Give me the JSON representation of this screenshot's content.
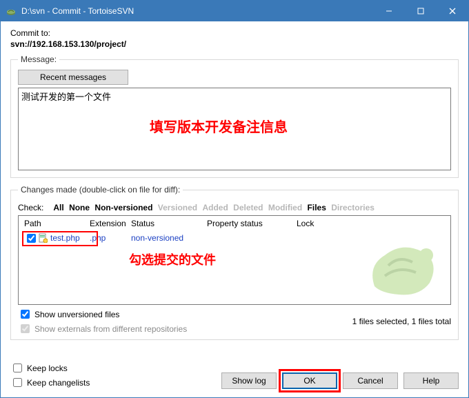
{
  "window": {
    "title": "D:\\svn - Commit - TortoiseSVN"
  },
  "commitTo": {
    "label": "Commit to:",
    "url": "svn://192.168.153.130/project/"
  },
  "messageSection": {
    "legend": "Message:",
    "recentButton": "Recent messages",
    "messageText": "测试开发的第一个文件",
    "annotation": "填写版本开发备注信息"
  },
  "changesSection": {
    "legend": "Changes made (double-click on file for diff):",
    "checkLabel": "Check:",
    "filters": {
      "all": "All",
      "none": "None",
      "nonversioned": "Non-versioned",
      "versioned": "Versioned",
      "added": "Added",
      "deleted": "Deleted",
      "modified": "Modified",
      "files": "Files",
      "directories": "Directories"
    },
    "columns": {
      "path": "Path",
      "extension": "Extension",
      "status": "Status",
      "propertyStatus": "Property status",
      "lock": "Lock"
    },
    "rows": [
      {
        "checked": true,
        "name": "test.php",
        "ext": ".php",
        "status": "non-versioned",
        "prop": "",
        "lock": ""
      }
    ],
    "annotation": "勾选提交的文件",
    "showUnversioned": "Show unversioned files",
    "showExternals": "Show externals from different repositories",
    "statusRight": "1 files selected, 1 files total"
  },
  "footer": {
    "keepLocks": "Keep locks",
    "keepChangelists": "Keep changelists",
    "showLog": "Show log",
    "ok": "OK",
    "cancel": "Cancel",
    "help": "Help"
  }
}
